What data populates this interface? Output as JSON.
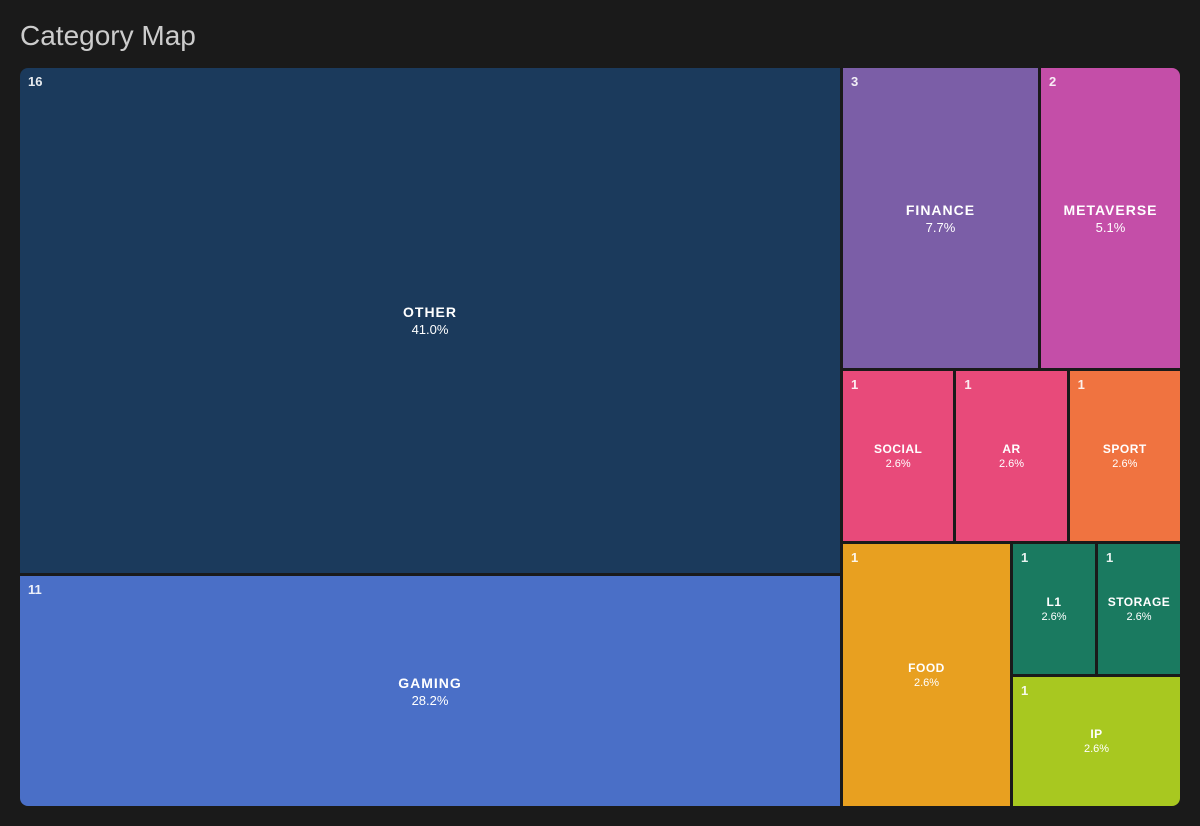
{
  "title": "Category Map",
  "cells": {
    "other": {
      "count": "16",
      "label": "OTHER",
      "value": "41.0%",
      "color": "#1b3a5c"
    },
    "gaming": {
      "count": "11",
      "label": "GAMING",
      "value": "28.2%",
      "color": "#4a6fc7"
    },
    "finance": {
      "count": "3",
      "label": "FINANCE",
      "value": "7.7%",
      "color": "#7b5ea7"
    },
    "metaverse": {
      "count": "2",
      "label": "METAVERSE",
      "value": "5.1%",
      "color": "#c44ea8"
    },
    "social": {
      "count": "1",
      "label": "SOCIAL",
      "value": "2.6%",
      "color": "#e84a7a"
    },
    "ar": {
      "count": "1",
      "label": "AR",
      "value": "2.6%",
      "color": "#e84a7a"
    },
    "sport": {
      "count": "1",
      "label": "SPORT",
      "value": "2.6%",
      "color": "#f07340"
    },
    "food": {
      "count": "1",
      "label": "FOOD",
      "value": "2.6%",
      "color": "#e8a020"
    },
    "l1": {
      "count": "1",
      "label": "L1",
      "value": "2.6%",
      "color": "#1a7a60"
    },
    "storage": {
      "count": "1",
      "label": "STORAGE",
      "value": "2.6%",
      "color": "#1a7a60"
    },
    "ip": {
      "count": "1",
      "label": "IP",
      "value": "2.6%",
      "color": "#a8c820"
    }
  }
}
